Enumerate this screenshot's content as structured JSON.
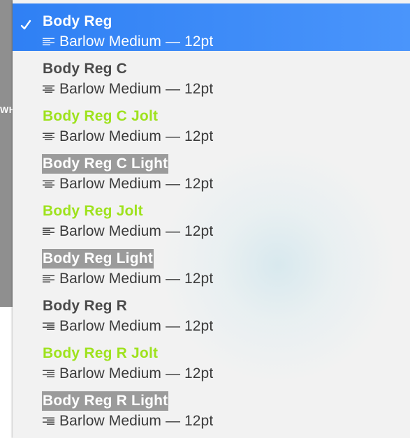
{
  "backdrop": {
    "label": "WHI"
  },
  "menu": {
    "items": [
      {
        "name": "Body Reg",
        "detail": "Barlow Medium — 12pt",
        "selected": true,
        "variant": "regular",
        "alignment": "align-left-icon"
      },
      {
        "name": "Body Reg C",
        "detail": "Barlow Medium — 12pt",
        "selected": false,
        "variant": "regular",
        "alignment": "align-center-icon"
      },
      {
        "name": "Body Reg C Jolt",
        "detail": "Barlow Medium — 12pt",
        "selected": false,
        "variant": "jolt",
        "alignment": "align-center-icon"
      },
      {
        "name": "Body Reg C Light",
        "detail": "Barlow Medium — 12pt",
        "selected": false,
        "variant": "light",
        "alignment": "align-center-icon"
      },
      {
        "name": "Body Reg Jolt",
        "detail": "Barlow Medium — 12pt",
        "selected": false,
        "variant": "jolt",
        "alignment": "align-left-icon"
      },
      {
        "name": "Body Reg Light",
        "detail": "Barlow Medium — 12pt",
        "selected": false,
        "variant": "light",
        "alignment": "align-left-icon"
      },
      {
        "name": "Body Reg R",
        "detail": "Barlow Medium — 12pt",
        "selected": false,
        "variant": "regular",
        "alignment": "align-right-icon"
      },
      {
        "name": "Body Reg R Jolt",
        "detail": "Barlow Medium — 12pt",
        "selected": false,
        "variant": "jolt",
        "alignment": "align-right-icon"
      },
      {
        "name": "Body Reg R Light",
        "detail": "Barlow Medium — 12pt",
        "selected": false,
        "variant": "light",
        "alignment": "align-right-icon"
      }
    ]
  },
  "colors": {
    "selection": "#2f80f4",
    "jolt": "#9ee21d",
    "light_bg": "#9b9b9b",
    "text": "#4a4a4a"
  }
}
